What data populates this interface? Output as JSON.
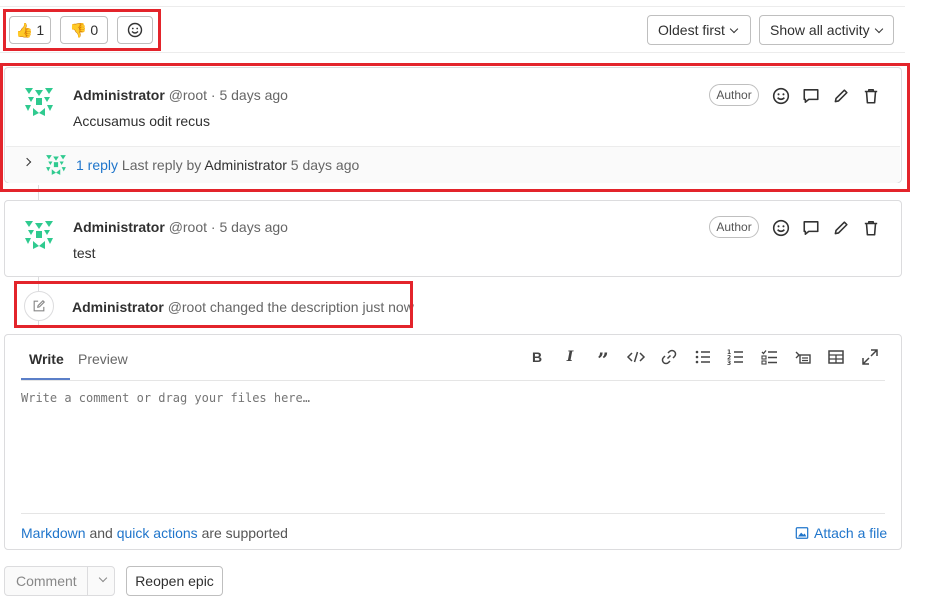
{
  "reactions": {
    "thumbs_up": {
      "emoji": "👍",
      "count": "1"
    },
    "thumbs_down": {
      "emoji": "👎",
      "count": "0"
    }
  },
  "sort": {
    "label": "Oldest first"
  },
  "filter": {
    "label": "Show all activity"
  },
  "notes": [
    {
      "author": "Administrator",
      "meta": "@root · 5 days ago",
      "badge": "Author",
      "body": "Accusamus odit recus",
      "reply": {
        "count": "1 reply",
        "text": "Last reply by",
        "author": "Administrator",
        "time": "5 days ago"
      }
    },
    {
      "author": "Administrator",
      "meta": "@root · 5 days ago",
      "badge": "Author",
      "body": "test"
    }
  ],
  "system_note": {
    "author": "Administrator",
    "text": "@root changed the description just now"
  },
  "editor": {
    "tabs": [
      "Write",
      "Preview"
    ],
    "placeholder": "Write a comment or drag your files here…",
    "footer": {
      "markdown": "Markdown",
      "and": "and",
      "quick_actions": "quick actions",
      "supported": "are supported",
      "attach": "Attach a file"
    }
  },
  "buttons": {
    "comment": "Comment",
    "reopen": "Reopen epic"
  },
  "colors": {
    "link": "#1f75cb",
    "highlight": "#e3242b",
    "avatar": "#2fca8f"
  }
}
